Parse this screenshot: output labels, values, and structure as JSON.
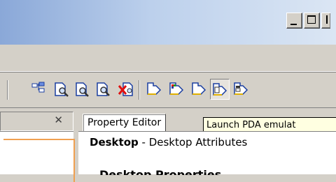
{
  "window": {
    "title": "",
    "controls": [
      "minimize",
      "maximize",
      "close"
    ]
  },
  "toolbar": {
    "buttons": [
      {
        "name": "tree-icon"
      },
      {
        "name": "find-doc-icon"
      },
      {
        "name": "preview-doc-icon"
      },
      {
        "name": "inspect-doc-icon"
      },
      {
        "name": "delete-doc-icon"
      },
      {
        "name": "launch-icon"
      },
      {
        "name": "launch-color-icon"
      },
      {
        "name": "launch-pda-emulator-icon",
        "pressed": true
      },
      {
        "name": "launch-device-icon"
      }
    ]
  },
  "left_panel": {
    "close_label": "✕"
  },
  "right_panel": {
    "tab_label": "Property Editor",
    "tooltip": "Launch PDA emulat",
    "editor": {
      "title_bold": "Desktop",
      "title_rest": " - Desktop Attributes",
      "cut_row_text": "Desktop Properties"
    }
  },
  "colors": {
    "window_bg": "#d4d0c8",
    "title_gradient_start": "#8aa8d8",
    "title_gradient_end": "#dbe6f4",
    "tooltip_bg": "#ffffe1",
    "accent_orange": "#f0a050"
  }
}
